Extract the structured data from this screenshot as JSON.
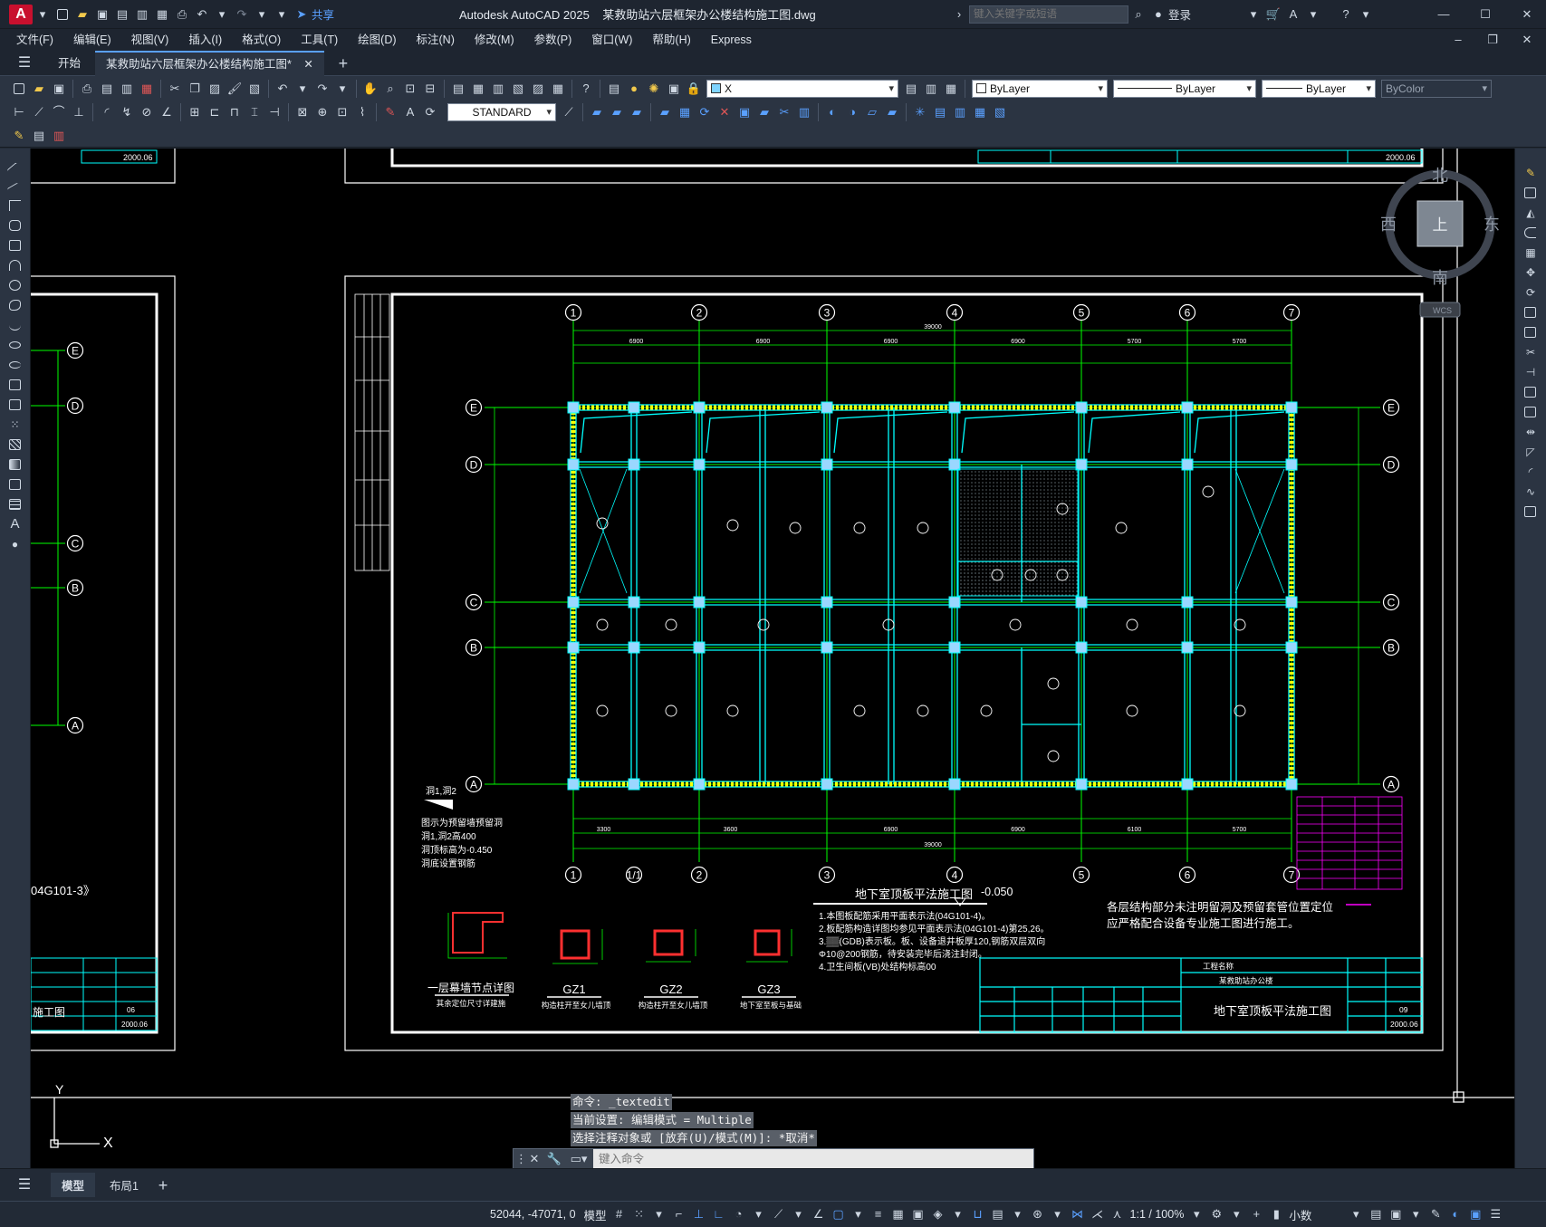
{
  "titlebar": {
    "app_letter": "A",
    "share": "共享",
    "title": "Autodesk AutoCAD 2025    某救助站六层框架办公楼结构施工图.dwg",
    "search_placeholder": "键入关键字或短语",
    "login": "登录"
  },
  "menus": [
    "文件(F)",
    "编辑(E)",
    "视图(V)",
    "插入(I)",
    "格式(O)",
    "工具(T)",
    "绘图(D)",
    "标注(N)",
    "修改(M)",
    "参数(P)",
    "窗口(W)",
    "帮助(H)",
    "Express"
  ],
  "tabs": {
    "start": "开始",
    "document": "某救助站六层框架办公楼结构施工图*"
  },
  "toolbars": {
    "layer_value": "X",
    "color_value": "ByLayer",
    "linetype_value": "ByLayer",
    "lineweight_value": "ByLayer",
    "plotstyle_value": "ByColor",
    "textstyle_value": "STANDARD"
  },
  "viewcube": {
    "north": "北",
    "south": "南",
    "east": "东",
    "west": "西",
    "top": "上",
    "wcs": "WCS"
  },
  "drawing": {
    "grid_columns": [
      "1",
      "2",
      "3",
      "4",
      "5",
      "6",
      "7"
    ],
    "grid_columns_bottom": [
      "1",
      "1/1",
      "2",
      "3",
      "4",
      "5",
      "6",
      "7"
    ],
    "grid_rows": [
      "E",
      "D",
      "C",
      "B",
      "A"
    ],
    "total_length": "39000",
    "top_spans": [
      "6900",
      "6900",
      "6900",
      "6900",
      "5700",
      "5700"
    ],
    "bottom_spans": [
      "3300",
      "3600",
      "6900",
      "6900",
      "6100",
      "5700",
      "5700"
    ],
    "plan_title": "地下室顶板平法施工图",
    "plan_level": "-0.050",
    "left_note_title": "洞1,洞2",
    "left_notes": [
      "图示为预留墙预留洞",
      "洞1,洞2高400",
      "洞顶标高为-0.450",
      "洞底设置钢筋"
    ],
    "right_note": [
      "各层结构部分未注明留洞及预留套管位置定位",
      "应严格配合设备专业施工图进行施工。"
    ],
    "notes_lines": [
      "1.本图板配筋采用平面表示法(04G101-4)。",
      "2.板配筋构造详图均参见平面表示法(04G101-4)第25,26。",
      "3.▒▒(GDB)表示板。板、设备退井板厚120,钢筋双层双向",
      "  Φ10@200钢筋，待安装完毕后浇注封闭。",
      "4.卫生间板(VB)处结构标高00"
    ],
    "detail_labels": [
      "一层幕墙节点详图",
      "GZ1",
      "GZ2",
      "GZ3"
    ],
    "detail_sublabels": [
      "其余定位尺寸详建施",
      "构造柱开至女儿墙顶",
      "构造柱开至女儿墙顶",
      "地下室至板与基础"
    ],
    "left_sheet_ref": "04G101-3》",
    "title_block": {
      "project_label": "工程名称",
      "project_name": "某救助站办公楼",
      "drawing_name": "地下室顶板平法施工图",
      "sheet_no": "09",
      "date": "2000.06",
      "left_drawing_name": "施工图",
      "left_sheet_no": "06",
      "left_date": "2000.06",
      "top_date": "2000.06"
    },
    "axis_x": "X",
    "axis_y": "Y"
  },
  "command": {
    "history": [
      "命令: _textedit",
      "当前设置: 编辑模式 = Multiple",
      "选择注释对象或 [放弃(U)/模式(M)]: *取消*"
    ],
    "placeholder": "键入命令"
  },
  "layout_tabs": [
    "模型",
    "布局1"
  ],
  "status": {
    "coords": "52044, -47071, 0",
    "mode": "模型",
    "scale": "1:1 / 100%",
    "units": "小数"
  }
}
